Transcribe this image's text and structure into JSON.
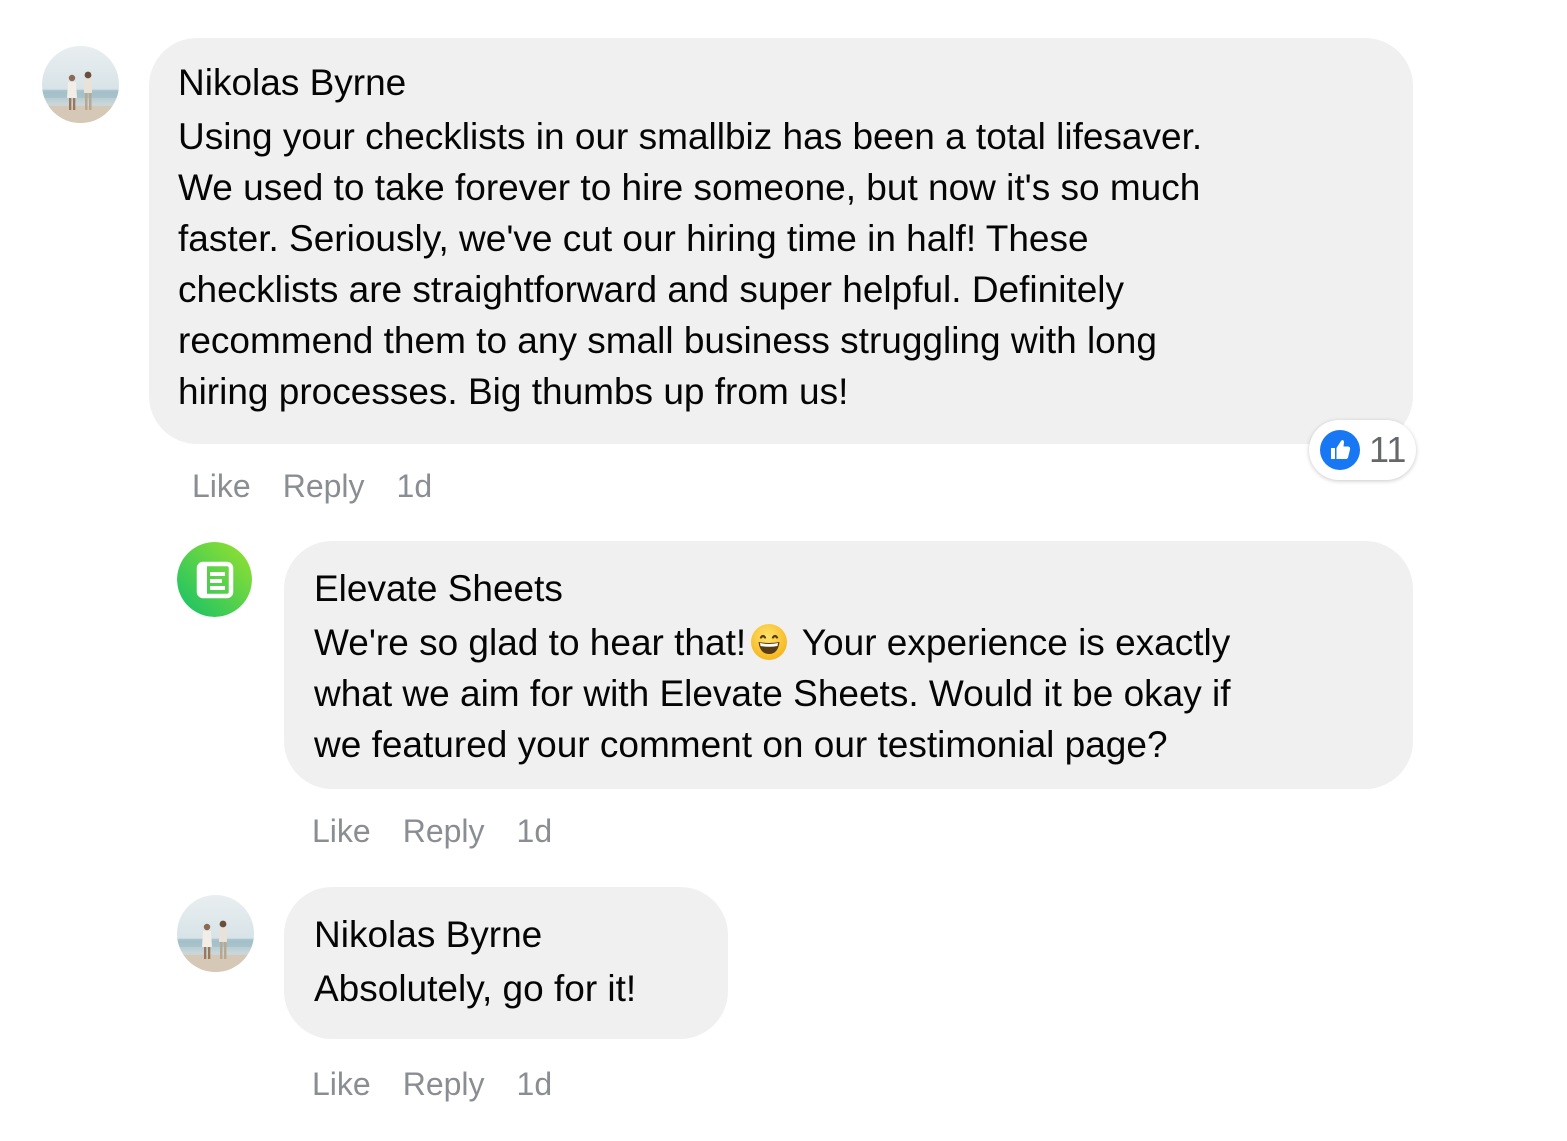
{
  "comments": [
    {
      "author": "Nikolas Byrne",
      "text": "Using your checklists in our smallbiz has been a total lifesaver.\nWe used to take forever to hire someone, but now it's so much\nfaster. Seriously, we've cut our hiring time in half! These\nchecklists are straightforward and super helpful. Definitely\nrecommend them to any small business struggling with long\nhiring processes. Big thumbs up from us!",
      "actions": {
        "like": "Like",
        "reply": "Reply",
        "time": "1d"
      },
      "reaction": {
        "icon": "thumbs-up-icon",
        "count": "11",
        "color": "#1877f2"
      }
    },
    {
      "author": "Elevate Sheets",
      "text_before_emoji": "We're so glad to hear that!",
      "emoji": "grinning-face-emoji",
      "text_after_emoji": "Your experience is exactly\nwhat we aim for with Elevate Sheets. Would it be okay if\nwe featured your comment on our testimonial page?",
      "actions": {
        "like": "Like",
        "reply": "Reply",
        "time": "1d"
      },
      "avatar_colors": [
        "#12c06a",
        "#9be22d"
      ]
    },
    {
      "author": "Nikolas Byrne",
      "text": "Absolutely, go for it!",
      "actions": {
        "like": "Like",
        "reply": "Reply",
        "time": "1d"
      }
    }
  ],
  "colors": {
    "bubble_bg": "#f0f0f0",
    "action_text": "#8a8d91",
    "text": "#050505"
  }
}
